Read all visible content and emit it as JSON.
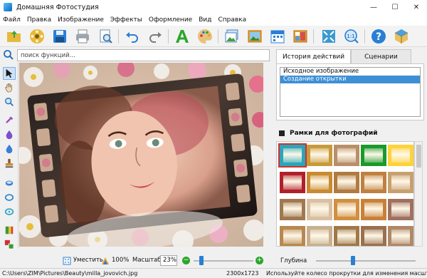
{
  "window": {
    "title": "Домашняя Фотостудия",
    "minimize_glyph": "—",
    "maximize_glyph": "☐",
    "close_glyph": "✕"
  },
  "menu": [
    "Файл",
    "Правка",
    "Изображение",
    "Эффекты",
    "Оформление",
    "Вид",
    "Справка"
  ],
  "toolbar": {
    "icons": [
      "open-folder-icon",
      "reel-icon",
      "save-icon",
      "print-icon",
      "preview-icon",
      "undo-icon",
      "redo-icon",
      "text-icon",
      "palette-icon",
      "photo-icon",
      "landscape-icon",
      "calendar-icon",
      "collage-icon",
      "fit-icon",
      "actual-size-icon",
      "help-icon",
      "package-icon"
    ]
  },
  "search": {
    "placeholder": "поиск функций..."
  },
  "left_tools": [
    "cursor-icon",
    "hand-icon",
    "zoom-icon",
    "pipette-icon",
    "drop-icon",
    "drop-blue-icon",
    "stamp-icon",
    "eraser-icon",
    "ring-icon",
    "ring2-icon",
    "layers-icon",
    "color-swap-icon"
  ],
  "zoom_controls": {
    "fit_label": "Уместить",
    "hundred_label": "100%",
    "scale_label": "Масштаб:",
    "scale_value": "23%",
    "slider_level": 0.1
  },
  "status": {
    "path": "C:\\Users\\ZIM\\Pictures\\Beauty\\milla_jovovich.jpg",
    "dimensions": "2300x1723",
    "hint": "Используйте колесо прокрутки для изменения масштаба"
  },
  "tabs": [
    {
      "label": "История действий",
      "active": true
    },
    {
      "label": "Сценарии",
      "active": false
    }
  ],
  "history": {
    "items": [
      "Исходное изображение",
      "Создание открытки"
    ],
    "selected": 1
  },
  "frames": {
    "title": "Рамки для фотографий",
    "thumbs": [
      [
        "#2aa6b8",
        "#c79a3b",
        "#b98f6a",
        "#1a9a2a",
        "#ffd23a"
      ],
      [
        "#b0202a",
        "#c98a30",
        "#b07a40",
        "#c08040",
        "#c8a070"
      ],
      [
        "#a07850",
        "#d8c0a0",
        "#d09040",
        "#c88038",
        "#a07060"
      ],
      [
        "#b88850",
        "#c8b090",
        "#a07848",
        "#9a7050",
        "#b08868"
      ]
    ]
  },
  "depth": {
    "label": "Глубина",
    "level": 0.35
  },
  "colors": {
    "selection": "#3d8fd6",
    "accent": "#1a73c8"
  }
}
